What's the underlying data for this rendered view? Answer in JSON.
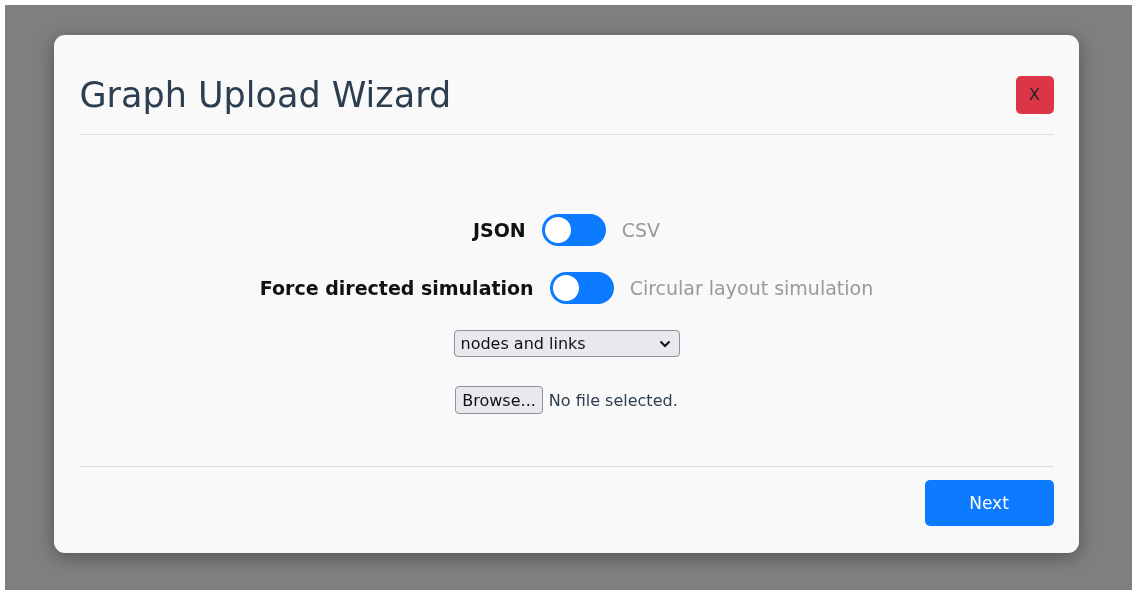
{
  "dialog": {
    "title": "Graph Upload Wizard",
    "close_label": "X"
  },
  "toggles": [
    {
      "options": [
        {
          "label": "JSON",
          "selected": true
        },
        {
          "label": "CSV",
          "selected": false
        }
      ]
    },
    {
      "options": [
        {
          "label": "Force directed simulation",
          "selected": true
        },
        {
          "label": "Circular layout simulation",
          "selected": false
        }
      ]
    }
  ],
  "select": {
    "value": "nodes and links"
  },
  "file_input": {
    "button": "Browse...",
    "status": "No file selected."
  },
  "footer": {
    "next": "Next"
  }
}
